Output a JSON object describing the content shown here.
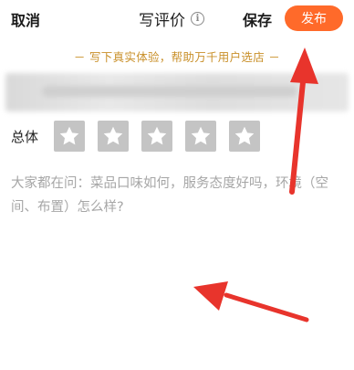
{
  "header": {
    "cancel_label": "取消",
    "title": "写评价",
    "info_icon": "info-icon",
    "save_label": "保存",
    "publish_label": "发布"
  },
  "slogan": "－ 写下真实体验，帮助万千用户选店 －",
  "rating": {
    "label": "总体",
    "max_stars": 5,
    "selected": 0
  },
  "review": {
    "placeholder": "大家都在问：菜品口味如何，服务态度好吗，环境（空间、布置）怎么样?"
  },
  "colors": {
    "accent": "#ff6a2a",
    "slogan": "#c9902a",
    "star_bg": "#c4c4c4",
    "annotation": "#e8342c"
  }
}
